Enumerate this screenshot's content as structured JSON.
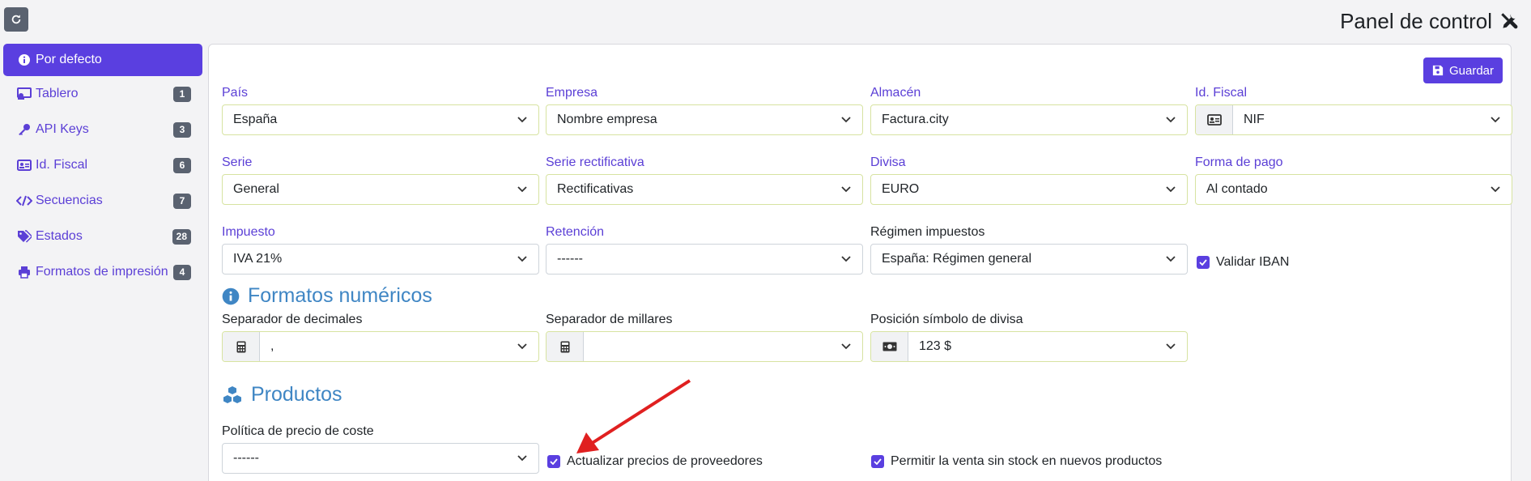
{
  "header": {
    "title": "Panel de control"
  },
  "sidebar": {
    "items": [
      {
        "label": "Por defecto",
        "icon": "info-circle-icon",
        "active": true
      },
      {
        "label": "Tablero",
        "icon": "dashboard-icon",
        "badge": "1"
      },
      {
        "label": "API Keys",
        "icon": "key-icon",
        "badge": "3"
      },
      {
        "label": "Id. Fiscal",
        "icon": "id-card-icon",
        "badge": "6"
      },
      {
        "label": "Secuencias",
        "icon": "code-icon",
        "badge": "7"
      },
      {
        "label": "Estados",
        "icon": "tags-icon",
        "badge": "28"
      },
      {
        "label": "Formatos de impresión",
        "icon": "print-icon",
        "badge": "4"
      }
    ]
  },
  "toolbar": {
    "save_label": "Guardar"
  },
  "form": {
    "pais": {
      "label": "País",
      "value": "España"
    },
    "empresa": {
      "label": "Empresa",
      "value": "Nombre empresa"
    },
    "almacen": {
      "label": "Almacén",
      "value": "Factura.city"
    },
    "idfiscal": {
      "label": "Id. Fiscal",
      "value": "NIF"
    },
    "serie": {
      "label": "Serie",
      "value": "General"
    },
    "serie_rect": {
      "label": "Serie rectificativa",
      "value": "Rectificativas"
    },
    "divisa": {
      "label": "Divisa",
      "value": "EURO"
    },
    "forma_pago": {
      "label": "Forma de pago",
      "value": "Al contado"
    },
    "impuesto": {
      "label": "Impuesto",
      "value": "IVA 21%"
    },
    "retencion": {
      "label": "Retención",
      "value": "------"
    },
    "regimen": {
      "label": "Régimen impuestos",
      "value": "España: Régimen general"
    },
    "validar_iban": {
      "label": "Validar IBAN",
      "checked": true
    }
  },
  "numeric": {
    "title": "Formatos numéricos",
    "decimales": {
      "label": "Separador de decimales",
      "value": ","
    },
    "millares": {
      "label": "Separador de millares",
      "value": ""
    },
    "posicion": {
      "label": "Posición símbolo de divisa",
      "value": "123 $"
    }
  },
  "products": {
    "title": "Productos",
    "politica": {
      "label": "Política de precio de coste",
      "value": "------"
    },
    "actualizar": {
      "label": "Actualizar precios de proveedores",
      "checked": true
    },
    "sin_stock": {
      "label": "Permitir la venta sin stock en nuevos productos",
      "checked": true
    }
  },
  "colors": {
    "accent": "#5a3fe0",
    "section": "#3f86c4",
    "annotation_arrow": "#e02020"
  }
}
